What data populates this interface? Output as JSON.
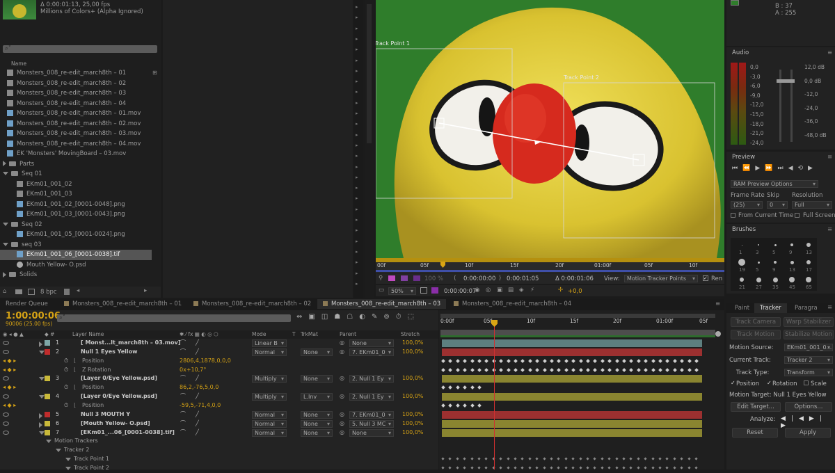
{
  "project": {
    "info_line1": "Δ 0:00:01:13, 25,00 fps",
    "info_line2": "Millions of Colors+ (Alpha Ignored)",
    "search_placeholder": "⌕˅",
    "col_name": "Name",
    "items": [
      {
        "label": "Monsters_008_re-edit_march8th – 01",
        "kind": "comp",
        "indent": 0
      },
      {
        "label": "Monsters_008_re-edit_march8th – 02",
        "kind": "comp",
        "indent": 0
      },
      {
        "label": "Monsters_008_re-edit_march8th – 03",
        "kind": "comp",
        "indent": 0
      },
      {
        "label": "Monsters_008_re-edit_march8th – 04",
        "kind": "comp",
        "indent": 0
      },
      {
        "label": "Monsters_008_re-edit_march8th – 01.mov",
        "kind": "file",
        "indent": 0
      },
      {
        "label": "Monsters_008_re-edit_march8th – 02.mov",
        "kind": "file",
        "indent": 0
      },
      {
        "label": "Monsters_008_re-edit_march8th – 03.mov",
        "kind": "file",
        "indent": 0
      },
      {
        "label": "Monsters_008_re-edit_march8th – 04.mov",
        "kind": "file",
        "indent": 0
      },
      {
        "label": "EK 'Monsters' MovingBoard – 03.mov",
        "kind": "file",
        "indent": 0
      },
      {
        "label": "Parts",
        "kind": "folder-closed",
        "indent": 0
      },
      {
        "label": "Seq 01",
        "kind": "folder-open",
        "indent": 0
      },
      {
        "label": "EKm01_001_02",
        "kind": "comp",
        "indent": 1
      },
      {
        "label": "EKm01_001_03",
        "kind": "comp",
        "indent": 1
      },
      {
        "label": "EKm01_001_02_[0001-0048].png",
        "kind": "file",
        "indent": 1
      },
      {
        "label": "EKm01_001_03_[0001-0043].png",
        "kind": "file",
        "indent": 1
      },
      {
        "label": "Seq 02",
        "kind": "folder-open",
        "indent": 0
      },
      {
        "label": "EKm01_001_05_[0001-0024].png",
        "kind": "file",
        "indent": 1
      },
      {
        "label": "seq 03",
        "kind": "folder-open",
        "indent": 0
      },
      {
        "label": "EKm01_001_06_[0001-0038].tif",
        "kind": "file",
        "indent": 1,
        "selected": true
      },
      {
        "label": "Mouth Yellow- O.psd",
        "kind": "psd",
        "indent": 1
      },
      {
        "label": "Solids",
        "kind": "folder-closed",
        "indent": 0
      }
    ],
    "bpc": "8 bpc"
  },
  "viewer": {
    "track_point_1": "Track Point 1",
    "track_point_2": "Track Point 2",
    "ruler_labels": [
      "00f",
      "05f",
      "10f",
      "15f",
      "20f",
      "01:00f",
      "05f",
      "10f"
    ],
    "zoom": "50%",
    "quality": "100 %",
    "time1": "0:00:00:00",
    "time2": "0:00:01:05",
    "delta": "Δ 0:00:01:06",
    "view_label": "View:",
    "view_value": "Motion Tracker Points",
    "render_label": "Ren",
    "current_time": "0:00:00:07",
    "exposure": "+0,0"
  },
  "info_panel": {
    "b": "B : 37",
    "a": "A : 255"
  },
  "audio": {
    "title": "Audio",
    "left_scale": [
      "0,0",
      "-3,0",
      "-6,0",
      "-9,0",
      "-12,0",
      "-15,0",
      "-18,0",
      "-21,0",
      "-24,0"
    ],
    "right_scale": [
      "12,0 dB",
      "0,0 dB",
      "-12,0",
      "-24,0",
      "-36,0",
      "-48,0 dB"
    ]
  },
  "preview": {
    "title": "Preview",
    "ram_options": "RAM Preview Options",
    "frame_rate_label": "Frame Rate",
    "skip_label": "Skip",
    "resolution_label": "Resolution",
    "frame_rate_value": "(25)",
    "skip_value": "0",
    "resolution_value": "Full",
    "from_current": "From Current Time",
    "full_screen": "Full Screen"
  },
  "brushes": {
    "title": "Brushes",
    "sizes": [
      "1",
      "3",
      "5",
      "9",
      "13",
      "19",
      "5",
      "9",
      "13",
      "17",
      "21",
      "27",
      "35",
      "45",
      "65"
    ]
  },
  "tabs": {
    "render_queue": "Render Queue",
    "comp_tabs": [
      "Monsters_008_re-edit_march8th – 01",
      "Monsters_008_re-edit_march8th – 02",
      "Monsters_008_re-edit_march8th – 03",
      "Monsters_008_re-edit_march8th – 04"
    ],
    "active_tab_index": 2
  },
  "timeline": {
    "timecode": "1:00:00:06",
    "frame_info": "90006 (25.00 fps)",
    "search_placeholder": "⌕˅",
    "col_layer_name": "Layer Name",
    "col_mode": "Mode",
    "col_t": "T",
    "col_trkmat": "TrkMat",
    "col_parent": "Parent",
    "col_stretch": "Stretch",
    "ruler_labels": [
      "0:00f",
      "05f",
      "10f",
      "15f",
      "20f",
      "01:00f",
      "05f"
    ],
    "layers": [
      {
        "num": "1",
        "name": "[ Monst...lt_march8th – 03.mov]",
        "color": "#7fa7a7",
        "mode": "Linear B",
        "trkmat": "",
        "parent": "None",
        "stretch": "100,0%",
        "bar_color": "#5d7f7f",
        "expanded": false
      },
      {
        "num": "2",
        "name": "Null 1 Eyes Yellow",
        "color": "#c02c2c",
        "mode": "Normal",
        "trkmat": "None",
        "parent": "7. EKm01_0",
        "stretch": "100,0%",
        "bar_color": "#9c3030",
        "expanded": true
      },
      {
        "prop": "Position",
        "value": "2806,4,1878,0,0,0"
      },
      {
        "prop": "Z Rotation",
        "value": "0x+10,7°"
      },
      {
        "num": "3",
        "name": "[Layer 0/Eye Yellow.psd]",
        "color": "#c9b93a",
        "mode": "Multiply",
        "trkmat": "None",
        "parent": "2. Null 1 Ey",
        "stretch": "100,0%",
        "bar_color": "#8a8530",
        "expanded": true
      },
      {
        "prop": "Position",
        "value": "86,2,-76,5,0,0"
      },
      {
        "num": "4",
        "name": "[Layer 0/Eye Yellow.psd]",
        "color": "#c9b93a",
        "mode": "Multiply",
        "trkmat": "L.Inv",
        "parent": "2. Null 1 Ey",
        "stretch": "100,0%",
        "bar_color": "#8a8530",
        "expanded": true
      },
      {
        "prop": "Position",
        "value": "-59,5,-71,4,0,0"
      },
      {
        "num": "5",
        "name": "Null 3 MOUTH Y",
        "color": "#c02c2c",
        "mode": "Normal",
        "trkmat": "None",
        "parent": "7. EKm01_0",
        "stretch": "100,0%",
        "bar_color": "#9c3030",
        "expanded": false
      },
      {
        "num": "6",
        "name": "[Mouth Yellow- O.psd]",
        "color": "#c9b93a",
        "mode": "Normal",
        "trkmat": "None",
        "parent": "5. Null 3 MC",
        "stretch": "100,0%",
        "bar_color": "#8a8530",
        "expanded": false
      },
      {
        "num": "7",
        "name": "[EKm01_...06_[0001-0038].tif]",
        "color": "#c9b93a",
        "mode": "Normal",
        "trkmat": "None",
        "parent": "None",
        "stretch": "100,0%",
        "bar_color": "#8a8530",
        "expanded": true
      }
    ],
    "sub_rows": [
      "Motion Trackers",
      "Tracker 2",
      "Track Point 1",
      "Track Point 2"
    ]
  },
  "tracker": {
    "tabs": [
      "Paint",
      "Tracker",
      "Paragra"
    ],
    "track_camera": "Track Camera",
    "warp_stabilizer": "Warp Stabilizer",
    "track_motion": "Track Motion",
    "stabilize_motion": "Stabilize Motion",
    "motion_source_label": "Motion Source:",
    "motion_source_value": "EKm01_001_0...",
    "current_track_label": "Current Track:",
    "current_track_value": "Tracker 2",
    "track_type_label": "Track Type:",
    "track_type_value": "Transform",
    "position": "Position",
    "rotation": "Rotation",
    "scale": "Scale",
    "motion_target": "Motion Target: Null 1 Eyes Yellow",
    "edit_target": "Edit Target...",
    "options": "Options...",
    "analyze": "Analyze:",
    "reset": "Reset",
    "apply": "Apply"
  }
}
